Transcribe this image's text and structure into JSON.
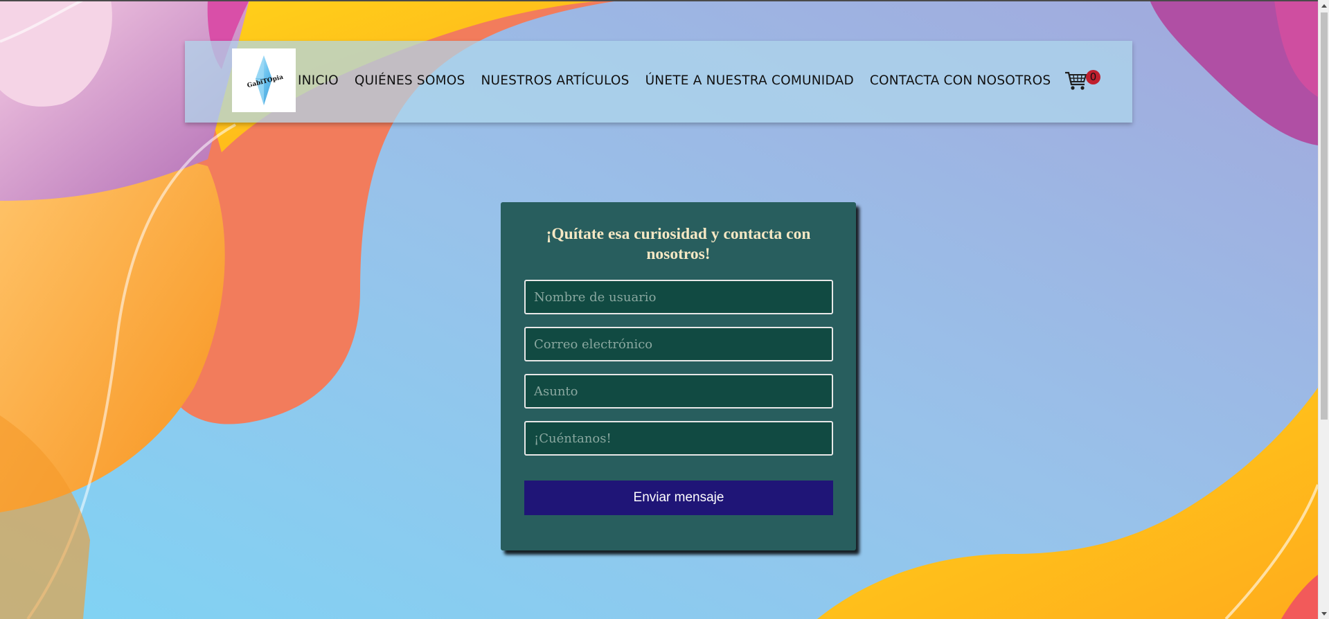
{
  "nav": {
    "logo_text": "GabiTOpia",
    "items": [
      {
        "label": "INICIO"
      },
      {
        "label": "QUIÉNES SOMOS"
      },
      {
        "label": "NUESTROS ARTÍCULOS"
      },
      {
        "label": "ÚNETE A NUESTRA COMUNIDAD"
      },
      {
        "label": "CONTACTA CON NOSOTROS"
      }
    ],
    "cart_icon": "shopping-cart-icon",
    "cart_count": "0"
  },
  "contact_form": {
    "title": "¡Quítate esa curiosidad y contacta con nosotros!",
    "username_placeholder": "Nombre de usuario",
    "email_placeholder": "Correo electrónico",
    "subject_placeholder": "Asunto",
    "message_placeholder": "¡Cuéntanos!",
    "submit_label": "Enviar mensaje"
  },
  "colors": {
    "card_bg": "#285e5e",
    "field_bg": "#114a42",
    "title_color": "#f6e8c4",
    "button_bg": "#1f1577",
    "badge_bg": "#c01f2e"
  }
}
